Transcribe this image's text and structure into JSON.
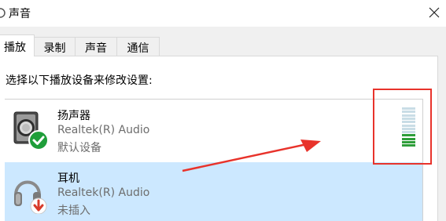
{
  "window": {
    "title": "声音",
    "close_icon": "close-icon"
  },
  "tabs": [
    {
      "label": "播放",
      "active": true
    },
    {
      "label": "录制",
      "active": false
    },
    {
      "label": "声音",
      "active": false
    },
    {
      "label": "通信",
      "active": false
    }
  ],
  "instruction": "选择以下播放设备来修改设置:",
  "devices": [
    {
      "name": "扬声器",
      "driver": "Realtek(R) Audio",
      "status": "默认设备",
      "icon": "speaker-icon",
      "badge_icon": "checkmark-badge-icon",
      "selected": false
    },
    {
      "name": "耳机",
      "driver": "Realtek(R) Audio",
      "status": "未插入",
      "icon": "headphones-icon",
      "badge_icon": "unplugged-badge-icon",
      "selected": true
    }
  ],
  "level_meter": {
    "active_segments": 4,
    "total_segments": 12
  },
  "colors": {
    "selection": "#cce8ff",
    "meter_active": "#2e9e3a",
    "meter_inactive": "#c9dde6",
    "annotation": "#e8332b",
    "check_badge": "#1f9e3a",
    "unplugged_badge": "#d83b2b"
  }
}
